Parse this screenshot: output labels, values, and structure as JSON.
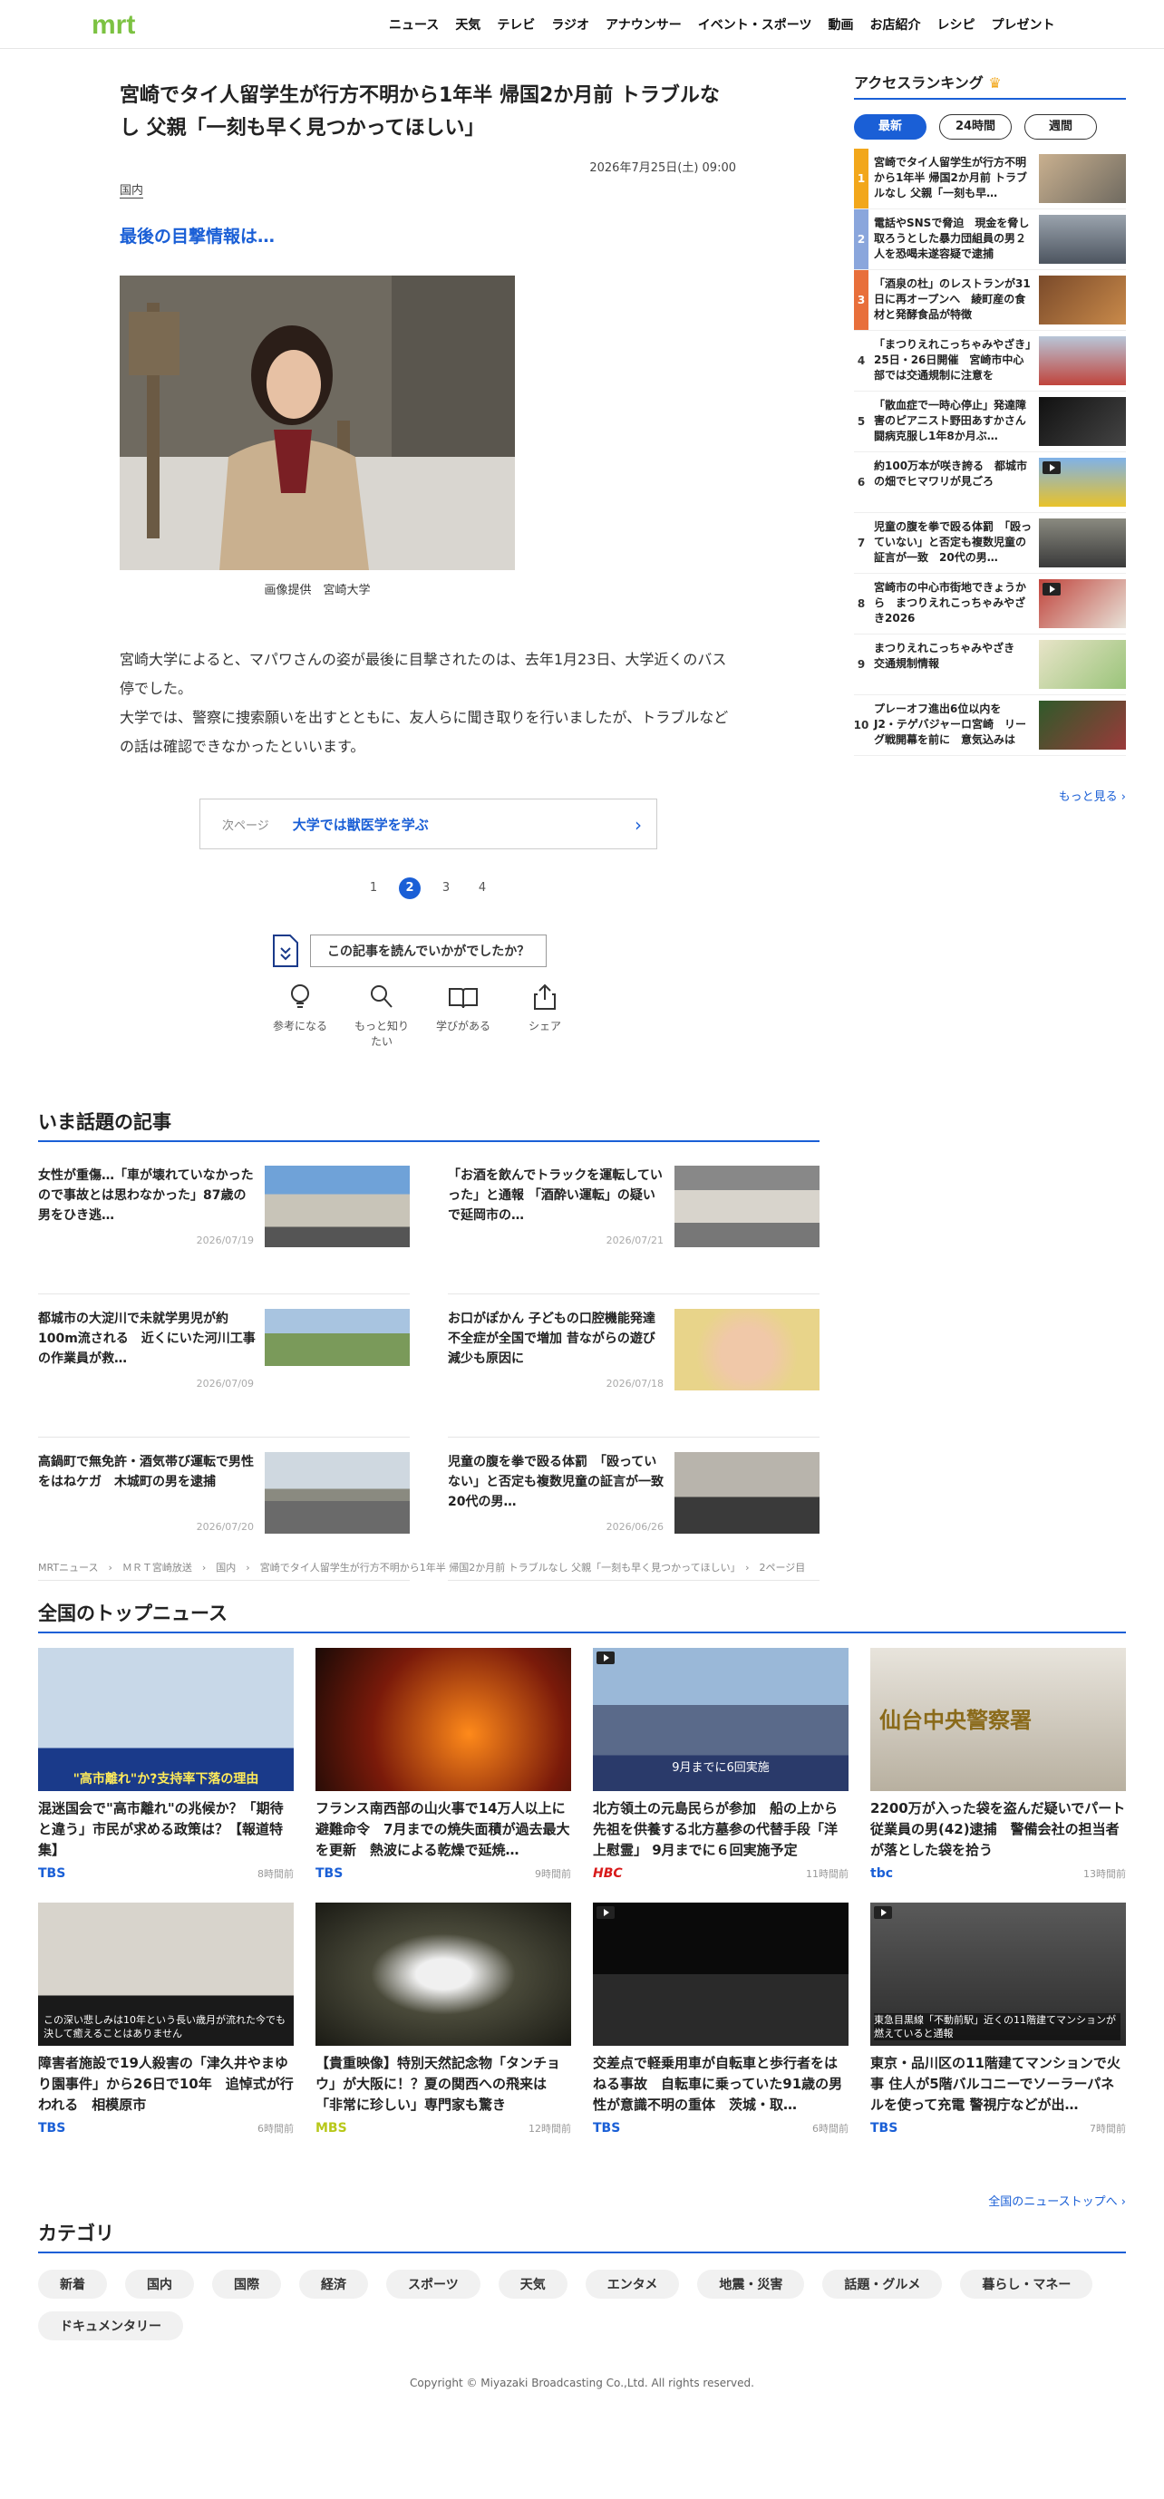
{
  "header": {
    "logo": "mrt",
    "nav": [
      "ニュース",
      "天気",
      "テレビ",
      "ラジオ",
      "アナウンサー",
      "イベント・スポーツ",
      "動画",
      "お店紹介",
      "レシピ",
      "プレゼント"
    ]
  },
  "article": {
    "title": "宮崎でタイ人留学生が行方不明から1年半 帰国2か月前 トラブルなし 父親「一刻も早く見つかってほしい」",
    "date": "2026年7月25日(土) 09:00",
    "category": "国内",
    "subheading": "最後の目撃情報は…",
    "caption": "画像提供　宮崎大学",
    "body1": "宮崎大学によると、マパワさんの姿が最後に目撃されたのは、去年1月23日、大学近くのバス停でした。",
    "body2": "大学では、警察に捜索願いを出すとともに、友人らに聞き取りを行いましたが、トラブルなどの話は確認できなかったといいます。",
    "next_label": "次ページ",
    "next_title": "大学では獣医学を学ぶ",
    "pages": [
      "1",
      "2",
      "3",
      "4"
    ],
    "current_page": "2",
    "survey": "この記事を読んでいかがでしたか？",
    "reactions": [
      "参考になる",
      "もっと知りたい",
      "学びがある",
      "シェア"
    ]
  },
  "ranking": {
    "title": "アクセスランキング",
    "tabs": [
      "最新",
      "24時間",
      "週間"
    ],
    "items": [
      {
        "rank": "1",
        "text": "宮崎でタイ人留学生が行方不明から1年半 帰国2か月前 トラブルなし 父親「一刻も早…"
      },
      {
        "rank": "2",
        "text": "電話やSNSで脅迫　現金を脅し取ろうとした暴力団組員の男２人を恐喝未遂容疑で逮捕"
      },
      {
        "rank": "3",
        "text": "「酒泉の杜」のレストランが31日に再オープンへ　綾町産の食材と発酵食品が特徴"
      },
      {
        "rank": "4",
        "text": "「まつりえれこっちゃみやざき」25日・26日開催　宮崎市中心部では交通規制に注意を"
      },
      {
        "rank": "5",
        "text": "「散血症で一時心停止」発達障害のピアニスト野田あすかさん　闘病克服し1年8か月ぶ…"
      },
      {
        "rank": "6",
        "text": "約100万本が咲き誇る　都城市の畑でヒマワリが見ごろ"
      },
      {
        "rank": "7",
        "text": "児童の腹を拳で殴る体罰　「殴っていない」と否定も複数児童の証言が一致　20代の男…"
      },
      {
        "rank": "8",
        "text": "宮崎市の中心市街地できょうから　まつりえれこっちゃみやざき2026"
      },
      {
        "rank": "9",
        "text": "まつりえれこっちゃみやざき　交通規制情報"
      },
      {
        "rank": "10",
        "text": "プレーオフ進出6位以内を　J2・テゲバジャーロ宮崎　リーグ戦開幕を前に　意気込みは"
      }
    ],
    "more": "もっと見る"
  },
  "topics": {
    "title": "いま話題の記事",
    "items": [
      {
        "text": "女性が重傷…「車が壊れていなかったので事故とは思わなかった」87歳の男をひき逃…",
        "date": "2026/07/19"
      },
      {
        "text": "「お酒を飲んでトラックを運転していった」と通報 「酒酔い運転」の疑いで延岡市の…",
        "date": "2026/07/21"
      },
      {
        "text": "都城市の大淀川で未就学男児が約100m流される　近くにいた河川工事の作業員が救…",
        "date": "2026/07/09"
      },
      {
        "text": "お口がぽかん 子どもの口腔機能発達不全症が全国で増加 昔ながらの遊び減少も原因に",
        "date": "2026/07/18"
      },
      {
        "text": "高鍋町で無免許・酒気帯び運転で男性をはねケガ　木城町の男を逮捕",
        "date": "2026/07/20"
      },
      {
        "text": "児童の腹を拳で殴る体罰　「殴っていない」と否定も複数児童の証言が一致　20代の男…",
        "date": "2026/06/26"
      }
    ]
  },
  "breadcrumb": "MRTニュース　›　ＭＲＴ宮崎放送　›　国内　›　宮崎でタイ人留学生が行方不明から1年半 帰国2か月前 トラブルなし 父親「一刻も早く見つかってほしい」　›　2ページ目",
  "national": {
    "title": "全国のトップニュース",
    "items": [
      {
        "text": "混迷国会で\"高市離れ\"の兆候か？「期待と違う」市民が求める政策は？【報道特集】",
        "brand": "TBS",
        "time": "8時間前",
        "overlay": "\"高市離れ\"か?支持率下落の理由"
      },
      {
        "text": "フランス南西部の山火事で14万人以上に避難命令　7月までの焼失面積が過去最大を更新　熱波による乾燥で延焼…",
        "brand": "TBS",
        "time": "9時間前",
        "overlay": ""
      },
      {
        "text": "北方領土の元島民らが参加　船の上から先祖を供養する北方墓参の代替手段「洋上慰霊」 9月までに６回実施予定",
        "brand": "HBC",
        "time": "11時間前",
        "overlay": "9月までに6回実施"
      },
      {
        "text": "2200万が入った袋を盗んだ疑いでパート従業員の男(42)逮捕　警備会社の担当者が落とした袋を拾う",
        "brand": "tbc",
        "time": "13時間前",
        "overlay": "仙台中央警察署"
      },
      {
        "text": "障害者施設で19人殺害の「津久井やまゆり園事件」から26日で10年　追悼式が行われる　相模原市",
        "brand": "TBS",
        "time": "6時間前",
        "overlay": "この深い悲しみは10年という長い歳月が流れた今でも決して癒えることはありません"
      },
      {
        "text": "【貴重映像】特別天然記念物「タンチョウ」が大阪に！？夏の関西への飛来は「非常に珍しい」専門家も驚き",
        "brand": "MBS",
        "time": "12時間前",
        "overlay": ""
      },
      {
        "text": "交差点で軽乗用車が自転車と歩行者をはねる事故　自転車に乗っていた91歳の男性が意識不明の重体　茨城・取…",
        "brand": "TBS",
        "time": "6時間前",
        "overlay": ""
      },
      {
        "text": "東京・品川区の11階建てマンションで火事 住人が5階バルコニーでソーラーパネルを使って充電 警視庁などが出…",
        "brand": "TBS",
        "time": "7時間前",
        "overlay": "東急目黒線「不動前駅」近くの11階建てマンションが燃えていると通報"
      }
    ],
    "more": "全国のニューストップへ"
  },
  "categories": {
    "title": "カテゴリ",
    "items": [
      "新着",
      "国内",
      "国際",
      "経済",
      "スポーツ",
      "天気",
      "エンタメ",
      "地震・災害",
      "話題・グルメ",
      "暮らし・マネー",
      "ドキュメンタリー"
    ]
  },
  "copyright": "Copyright © Miyazaki Broadcasting Co.,Ltd. All rights reserved.",
  "colors": {
    "accent": "#1a5fd6",
    "logo": "#7cc242",
    "rank1": "#f2a71b",
    "rank2": "#8aa6dc",
    "rank3": "#e86f3b"
  }
}
